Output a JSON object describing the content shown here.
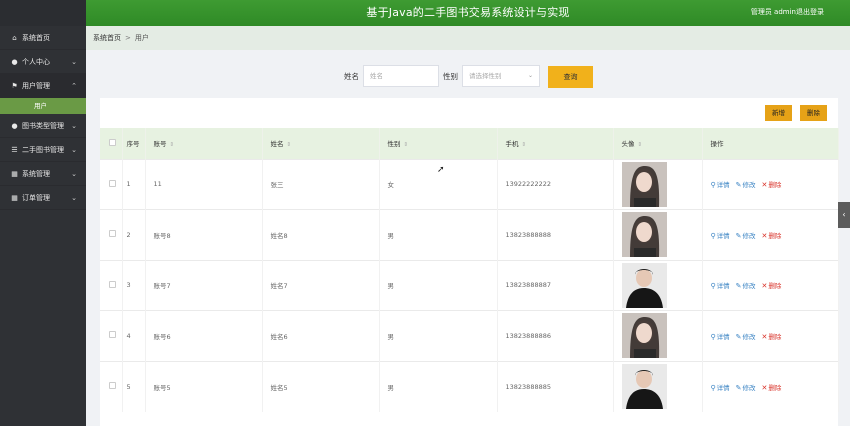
{
  "header": {
    "title": "基于Java的二手图书交易系统设计与实现",
    "user_label": "管理员 admin",
    "logout": "退出登录"
  },
  "sidebar": {
    "items": [
      {
        "label": "系统首页",
        "icon": "home-icon"
      },
      {
        "label": "个人中心",
        "icon": "person-icon"
      },
      {
        "label": "用户管理",
        "icon": "flag-icon"
      },
      {
        "label": "图书类型管理",
        "icon": "person-icon"
      },
      {
        "label": "二手图书管理",
        "icon": "sliders-icon"
      },
      {
        "label": "系统管理",
        "icon": "grid-icon"
      },
      {
        "label": "订单管理",
        "icon": "grid-icon"
      }
    ],
    "sub_item": "用户"
  },
  "breadcrumb": {
    "home": "系统首页",
    "sep": ">",
    "current": "用户"
  },
  "search": {
    "name_label": "姓名",
    "name_placeholder": "姓名",
    "gender_label": "性别",
    "gender_placeholder": "请选择性别",
    "button": "查询"
  },
  "toolbar": {
    "add": "新增",
    "delete": "删除"
  },
  "table": {
    "headers": [
      "序号",
      "账号",
      "姓名",
      "性别",
      "手机",
      "头像",
      "操作"
    ],
    "actions": {
      "detail": "详情",
      "edit": "修改",
      "delete": "删除"
    },
    "rows": [
      {
        "index": "1",
        "account": "11",
        "name": "张三",
        "gender": "女",
        "phone": "13922222222",
        "avatar": "girl-portrait"
      },
      {
        "index": "2",
        "account": "账号8",
        "name": "姓名8",
        "gender": "男",
        "phone": "13823888888",
        "avatar": "girl-portrait"
      },
      {
        "index": "3",
        "account": "账号7",
        "name": "姓名7",
        "gender": "男",
        "phone": "13823888887",
        "avatar": "boy-portrait"
      },
      {
        "index": "4",
        "account": "账号6",
        "name": "姓名6",
        "gender": "男",
        "phone": "13823888886",
        "avatar": "girl-portrait"
      },
      {
        "index": "5",
        "account": "账号5",
        "name": "姓名5",
        "gender": "男",
        "phone": "13823888885",
        "avatar": "boy-portrait"
      }
    ]
  },
  "colors": {
    "header_green": "#2f8a26",
    "accent_yellow": "#f1b11b",
    "sidebar_bg": "#2f3135",
    "sub_active": "#6a9a45"
  }
}
